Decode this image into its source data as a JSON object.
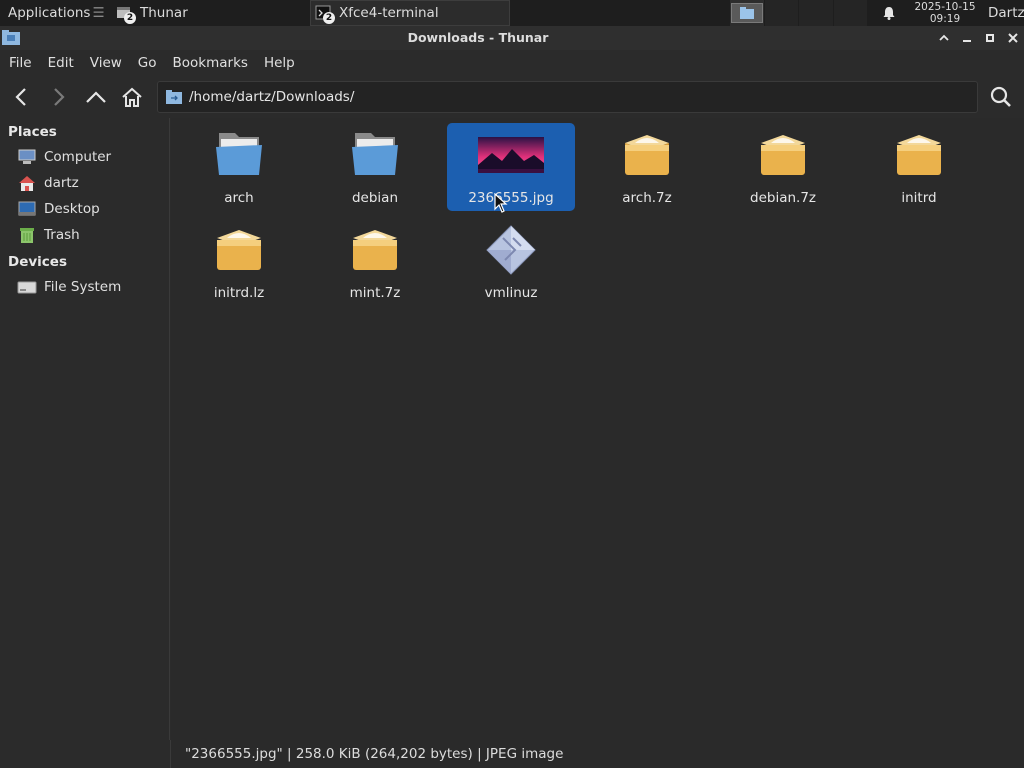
{
  "taskbar": {
    "apps_label": "Applications",
    "windows": [
      {
        "label": "Thunar",
        "badge": "2"
      },
      {
        "label": "Xfce4-terminal",
        "badge": "2"
      }
    ],
    "clock_date": "2025-10-15",
    "clock_time": "09:19",
    "user": "Dartz"
  },
  "window": {
    "title": "Downloads - Thunar"
  },
  "menu": [
    "File",
    "Edit",
    "View",
    "Go",
    "Bookmarks",
    "Help"
  ],
  "location": {
    "path": "/home/dartz/Downloads/"
  },
  "sidebar": {
    "places_heading": "Places",
    "places": [
      "Computer",
      "dartz",
      "Desktop",
      "Trash"
    ],
    "devices_heading": "Devices",
    "devices": [
      "File System"
    ]
  },
  "files": [
    {
      "name": "arch",
      "type": "folder"
    },
    {
      "name": "debian",
      "type": "folder"
    },
    {
      "name": "2366555.jpg",
      "type": "image",
      "selected": true
    },
    {
      "name": "arch.7z",
      "type": "archive"
    },
    {
      "name": "debian.7z",
      "type": "archive"
    },
    {
      "name": "initrd",
      "type": "archive"
    },
    {
      "name": "initrd.lz",
      "type": "archive"
    },
    {
      "name": "mint.7z",
      "type": "archive"
    },
    {
      "name": "vmlinuz",
      "type": "executable"
    }
  ],
  "status": {
    "text": "\"2366555.jpg\"  |  258.0 KiB (264,202 bytes)  |  JPEG image"
  },
  "colors": {
    "selection": "#1c5fb0",
    "folder": "#5b9bd8",
    "archive": "#e8b04a"
  }
}
